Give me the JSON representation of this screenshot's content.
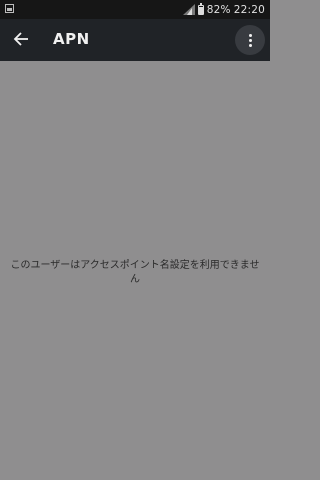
{
  "status_bar": {
    "battery_percent": "82%",
    "battery_level": 0.82,
    "time": "22:20",
    "left_icon": "image-notification-icon",
    "signal_icon": "cell-signal-icon",
    "battery_icon": "battery-icon"
  },
  "app_bar": {
    "title": "APN",
    "back_icon": "arrow-back-icon",
    "more_icon": "more-vert-icon"
  },
  "main": {
    "message": "このユーザーはアクセスポイント名設定を利用できません"
  },
  "colors": {
    "status_bar_bg": "#161616",
    "app_bar_bg": "#202327",
    "content_bg": "#8f8e8f",
    "message_text": "#2b2b2b"
  }
}
